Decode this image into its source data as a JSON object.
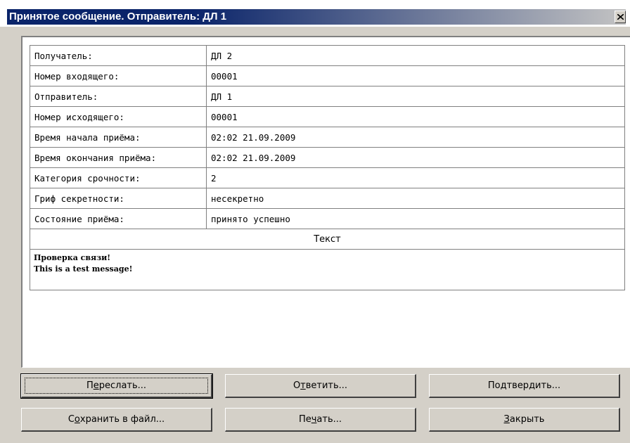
{
  "window": {
    "title": "Принятое сообщение. Отправитель: ДЛ 1"
  },
  "fields": [
    {
      "label": "Получатель:",
      "value": "ДЛ 2"
    },
    {
      "label": "Номер входящего:",
      "value": "00001"
    },
    {
      "label": "Отправитель:",
      "value": "ДЛ 1"
    },
    {
      "label": "Номер исходящего:",
      "value": "00001"
    },
    {
      "label": "Время начала приёма:",
      "value": "02:02 21.09.2009"
    },
    {
      "label": "Время окончания приёма:",
      "value": "02:02 21.09.2009"
    },
    {
      "label": "Категория срочности:",
      "value": "2"
    },
    {
      "label": "Гриф секретности:",
      "value": "несекретно"
    },
    {
      "label": "Состояние приёма:",
      "value": "принято успешно"
    }
  ],
  "text_section": {
    "header": "Текст",
    "lines": [
      "Проверка связи!",
      "This is a test message!"
    ]
  },
  "buttons": {
    "forward": {
      "pre": "П",
      "key": "е",
      "post": "реслать..."
    },
    "reply": {
      "pre": "О",
      "key": "т",
      "post": "ветить..."
    },
    "confirm": {
      "pre": "По",
      "key": "д",
      "post": "твердить..."
    },
    "save": {
      "pre": "С",
      "key": "о",
      "post": "хранить в файл..."
    },
    "print": {
      "pre": "Пе",
      "key": "ч",
      "post": "ать..."
    },
    "close": {
      "pre": "",
      "key": "З",
      "post": "акрыть"
    }
  },
  "icons": {
    "close": "close-x-icon"
  }
}
